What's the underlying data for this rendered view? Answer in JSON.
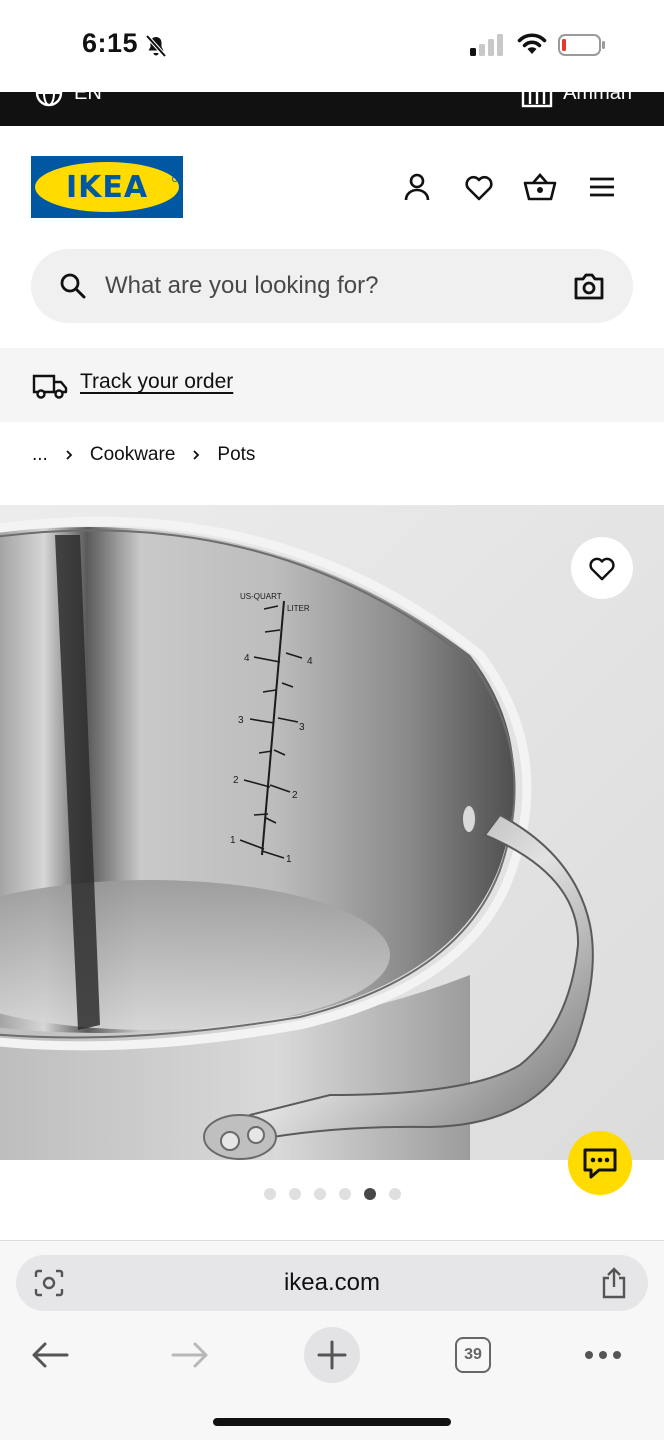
{
  "status_bar": {
    "time": "6:15"
  },
  "utility_bar": {
    "language": "EN",
    "store": "Amman"
  },
  "header": {
    "logo_text": "IKEA",
    "brand_colors": {
      "blue": "#0058a3",
      "yellow": "#ffdb00"
    },
    "icons": [
      "person-icon",
      "heart-icon",
      "basket-icon",
      "menu-icon"
    ]
  },
  "search": {
    "placeholder": "What are you looking for?"
  },
  "track": {
    "label": "Track your order"
  },
  "breadcrumb": {
    "ellipsis": "...",
    "items": [
      "Cookware",
      "Pots"
    ]
  },
  "gallery": {
    "total_images": 6,
    "active_index": 4,
    "measuring_scale": {
      "left_label": "US-QUART",
      "right_label": "LITER",
      "quart_marks": [
        "4",
        "3",
        "2",
        "1"
      ],
      "liter_marks": [
        "4",
        "3",
        "2",
        "1"
      ]
    }
  },
  "browser": {
    "url": "ikea.com",
    "tab_count": "39"
  }
}
